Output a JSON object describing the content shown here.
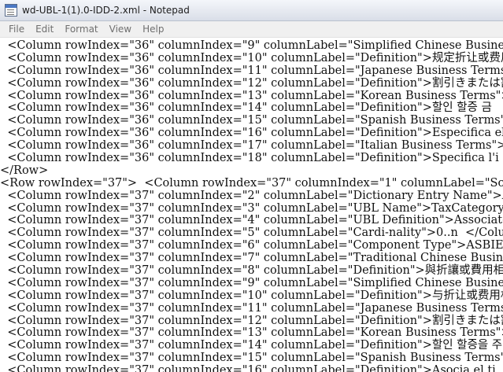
{
  "window": {
    "title": "wd-UBL-1(1).0-IDD-2.xml - Notepad"
  },
  "menu": [
    "File",
    "Edit",
    "Format",
    "View",
    "Help"
  ],
  "editor": {
    "lines": [
      "  <Column rowIndex=\"36\" columnIndex=\"9\" columnLabel=\"Simplified Chinese Busines",
      "  <Column rowIndex=\"36\" columnIndex=\"10\" columnLabel=\"Definition\">规定折让或费用",
      "  <Column rowIndex=\"36\" columnIndex=\"11\" columnLabel=\"Japanese Business Terms\">",
      "  <Column rowIndex=\"36\" columnIndex=\"12\" columnLabel=\"Definition\">割引きまたは割",
      "  <Column rowIndex=\"36\" columnIndex=\"13\" columnLabel=\"Korean Business Terms\">금",
      "  <Column rowIndex=\"36\" columnIndex=\"14\" columnLabel=\"Definition\">할인 할증 금",
      "  <Column rowIndex=\"36\" columnIndex=\"15\" columnLabel=\"Spanish Business Terms\">I",
      "  <Column rowIndex=\"36\" columnIndex=\"16\" columnLabel=\"Definition\">Especifica el",
      "  <Column rowIndex=\"36\" columnIndex=\"17\" columnLabel=\"Italian Business Terms\">I",
      "  <Column rowIndex=\"36\" columnIndex=\"18\" columnLabel=\"Definition\">Specifica l'i",
      "</Row>",
      "<Row rowIndex=\"37\">  <Column rowIndex=\"37\" columnIndex=\"1\" columnLabel=\"Schema",
      "  <Column rowIndex=\"37\" columnIndex=\"2\" columnLabel=\"Dictionary Entry Name\">All",
      "  <Column rowIndex=\"37\" columnIndex=\"3\" columnLabel=\"UBL Name\">TaxCategory  </C",
      "  <Column rowIndex=\"37\" columnIndex=\"4\" columnLabel=\"UBL Definition\">Associates",
      "  <Column rowIndex=\"37\" columnIndex=\"5\" columnLabel=\"Cardi-nality\">0..n  </Colu",
      "  <Column rowIndex=\"37\" columnIndex=\"6\" columnLabel=\"Component Type\">ASBIE  </C",
      "  <Column rowIndex=\"37\" columnIndex=\"7\" columnLabel=\"Traditional Chinese Busine",
      "  <Column rowIndex=\"37\" columnIndex=\"8\" columnLabel=\"Definition\">與折讓或費用相",
      "  <Column rowIndex=\"37\" columnIndex=\"9\" columnLabel=\"Simplified Chinese Busines",
      "  <Column rowIndex=\"37\" columnIndex=\"10\" columnLabel=\"Definition\">与折让或费用相",
      "  <Column rowIndex=\"37\" columnIndex=\"11\" columnLabel=\"Japanese Business Terms\">",
      "  <Column rowIndex=\"37\" columnIndex=\"12\" columnLabel=\"Definition\">割引きまたは割",
      "  <Column rowIndex=\"37\" columnIndex=\"13\" columnLabel=\"Korean Business Terms\">세",
      "  <Column rowIndex=\"37\" columnIndex=\"14\" columnLabel=\"Definition\">할인 할증을 주",
      "  <Column rowIndex=\"37\" columnIndex=\"15\" columnLabel=\"Spanish Business Terms\">C",
      "  <Column rowIndex=\"37\" columnIndex=\"16\" columnLabel=\"Definition\">Asocia el ti"
    ]
  }
}
